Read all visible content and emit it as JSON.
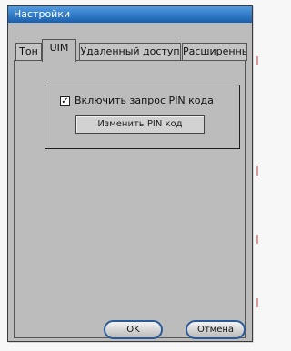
{
  "window": {
    "title": "Настройки"
  },
  "tabs": [
    {
      "label": "Тон",
      "active": false
    },
    {
      "label": "UIM",
      "active": true
    },
    {
      "label": "Удаленный доступ",
      "active": false
    },
    {
      "label": "Расширенные",
      "active": false
    }
  ],
  "uim": {
    "pin_checkbox_label": "Включить запрос PIN кода",
    "pin_checkbox_checked": true,
    "pin_checkbox_mark": "✓",
    "change_pin_label": "Изменить PIN код"
  },
  "buttons": {
    "ok_label": "OK",
    "cancel_label": "Отмена"
  },
  "colors": {
    "title_bar": "#2a6fc0",
    "window_bg": "#bcbcbc",
    "button_border": "#2a5a9a"
  }
}
